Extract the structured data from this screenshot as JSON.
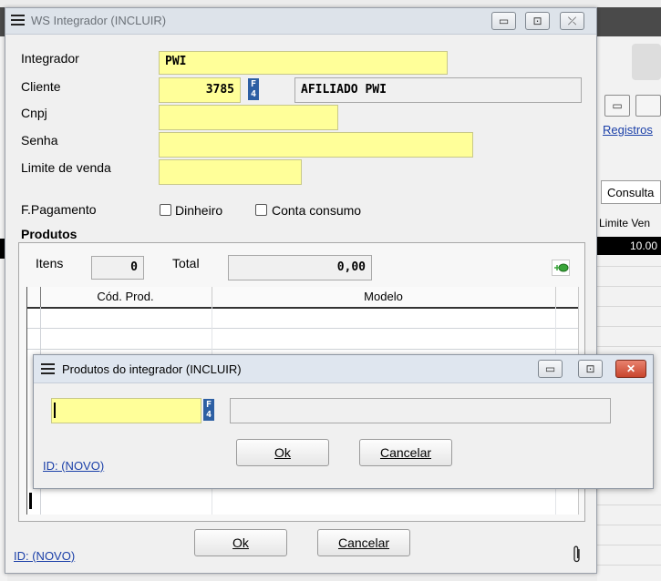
{
  "main_dialog": {
    "title": "WS Integrador (INCLUIR)",
    "window_buttons": {
      "minimize": "▭",
      "maximize": "⊡",
      "close": "⤫"
    },
    "fields": {
      "integrador": {
        "label": "Integrador",
        "value": "PWI"
      },
      "cliente": {
        "label": "Cliente",
        "code": "3785",
        "f4_label": "F4",
        "name": "AFILIADO PWI"
      },
      "cnpj": {
        "label": "Cnpj",
        "value": ""
      },
      "senha": {
        "label": "Senha",
        "value": ""
      },
      "limite_venda": {
        "label": "Limite de venda",
        "value": ""
      }
    },
    "pagamento": {
      "label": "F.Pagamento",
      "options": [
        {
          "label": "Dinheiro",
          "checked": false
        },
        {
          "label": "Conta consumo",
          "checked": false
        }
      ]
    },
    "produtos": {
      "section_title": "Produtos",
      "itens_label": "Itens",
      "itens_value": "0",
      "total_label": "Total",
      "total_value": "0,00",
      "add_icon": "add-green-icon",
      "columns": [
        "Cód. Prod.",
        "Modelo"
      ]
    },
    "buttons": {
      "ok": "Ok",
      "cancelar": "Cancelar"
    },
    "id_link": "ID: (NOVO)",
    "attach_icon": "paperclip-icon"
  },
  "sub_dialog": {
    "title": "Produtos do integrador (INCLUIR)",
    "product_code": "",
    "f4_label": "F4",
    "product_name": "",
    "buttons": {
      "ok": "Ok",
      "cancelar": "Cancelar"
    },
    "id_link": "ID: (NOVO)"
  },
  "background_app": {
    "link": "Registros",
    "consulta": "Consulta",
    "limite_label": "Limite Ven",
    "limite_value": "10.00"
  }
}
